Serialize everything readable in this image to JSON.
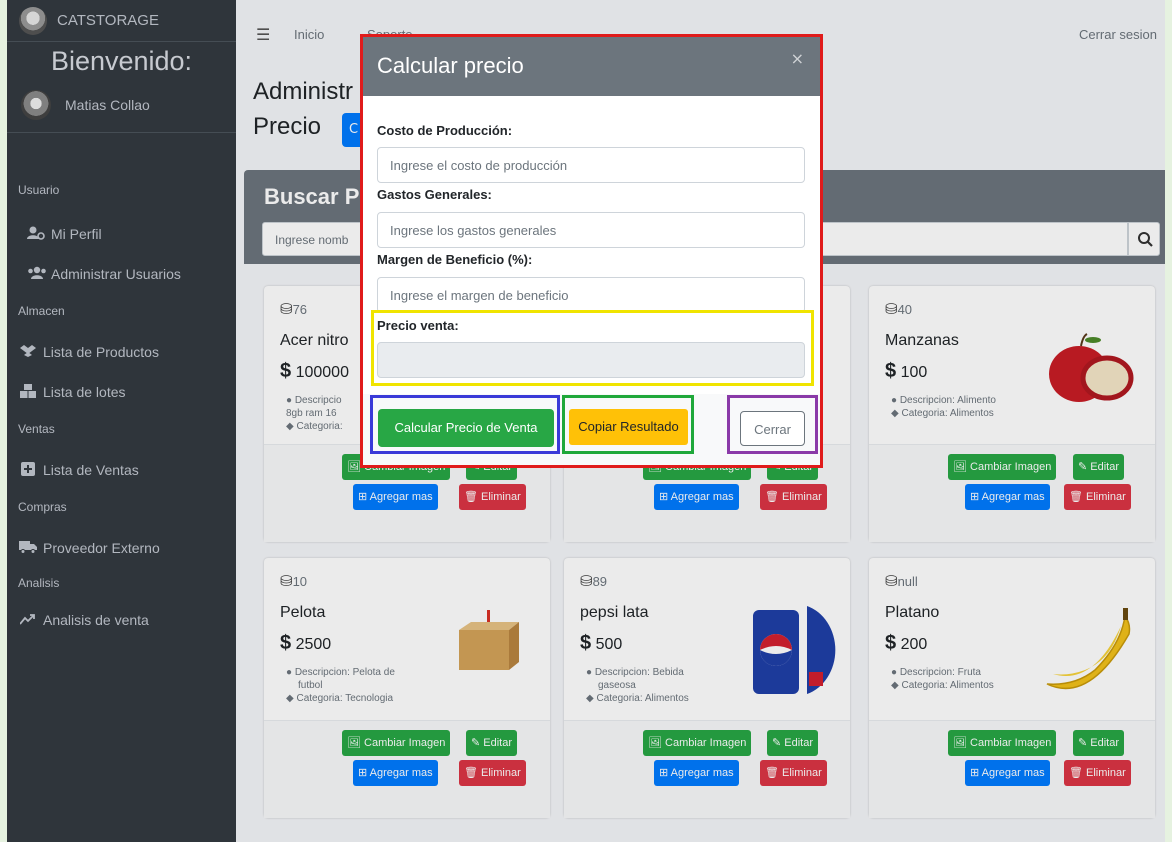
{
  "brand": {
    "name": "CATSTORAGE"
  },
  "sidebar": {
    "welcome": "Bienvenido:",
    "user_name": "Matias Collao",
    "sections": [
      {
        "header": "Usuario",
        "items": [
          {
            "label": "Mi Perfil",
            "icon": "user-cog-icon"
          },
          {
            "label": "Administrar Usuarios",
            "icon": "users-icon"
          }
        ]
      },
      {
        "header": "Almacen",
        "items": [
          {
            "label": "Lista de Productos",
            "icon": "dropbox-icon"
          },
          {
            "label": "Lista de lotes",
            "icon": "boxes-icon"
          }
        ]
      },
      {
        "header": "Ventas",
        "items": [
          {
            "label": "Lista de Ventas",
            "icon": "cart-plus-icon"
          }
        ]
      },
      {
        "header": "Compras",
        "items": [
          {
            "label": "Proveedor Externo",
            "icon": "truck-icon"
          }
        ]
      },
      {
        "header": "Analisis",
        "items": [
          {
            "label": "Analisis de venta",
            "icon": "chart-line-icon"
          }
        ]
      }
    ]
  },
  "topbar": {
    "home": "Inicio",
    "support": "Soporte",
    "logout": "Cerrar sesion"
  },
  "content": {
    "title": "Administr",
    "subtitle": "Precio",
    "subtitle_btn": "C"
  },
  "search": {
    "title": "Buscar P",
    "placeholder": "Ingrese nomb"
  },
  "products": [
    {
      "stock": "76",
      "name": "Acer nitro",
      "price": "100000",
      "desc": "Descripcio",
      "desc2": "8gb ram 16",
      "cat": "Categoria:"
    },
    {
      "stock": "",
      "name": "",
      "price": "",
      "desc": "",
      "desc2": "",
      "cat": ""
    },
    {
      "stock": "40",
      "name": "Manzanas",
      "price": "100",
      "desc": "Descripcion: Alimento",
      "desc2": "",
      "cat": "Categoria: Alimentos"
    },
    {
      "stock": "10",
      "name": "Pelota",
      "price": "2500",
      "desc": "Descripcion: Pelota de",
      "desc2": "futbol",
      "cat": "Categoria: Tecnologia"
    },
    {
      "stock": "89",
      "name": "pepsi lata",
      "price": "500",
      "desc": "Descripcion: Bebida",
      "desc2": "gaseosa",
      "cat": "Categoria: Alimentos"
    },
    {
      "stock": "null",
      "name": "Platano",
      "price": "200",
      "desc": "Descripcion: Fruta",
      "desc2": "",
      "cat": "Categoria: Alimentos"
    }
  ],
  "card_buttons": {
    "change_image": "Cambiar Imagen",
    "edit": "Editar",
    "add_more": "Agregar mas",
    "delete": "Eliminar"
  },
  "currency": "$",
  "modal": {
    "title": "Calcular precio",
    "close_symbol": "×",
    "fields": [
      {
        "label": "Costo de Producción:",
        "placeholder": "Ingrese el costo de producción"
      },
      {
        "label": "Gastos Generales:",
        "placeholder": "Ingrese los gastos generales"
      },
      {
        "label": "Margen de Beneficio (%):",
        "placeholder": "Ingrese el margen de beneficio"
      }
    ],
    "result_label": "Precio venta:",
    "result_value": "",
    "calc_button": "Calcular Precio de Venta",
    "copy_button": "Copiar Resultado",
    "close_button": "Cerrar"
  },
  "colors": {
    "sidebar_bg": "#343a40",
    "accent_blue": "#007bff",
    "green": "#28a745",
    "red": "#dc3545",
    "yellow": "#ffc107",
    "highlight_red": "#e01b1b",
    "highlight_yellow": "#f0e400",
    "highlight_blue": "#3a3ad8",
    "highlight_green": "#1fa83a",
    "highlight_purple": "#8a3aa8"
  }
}
